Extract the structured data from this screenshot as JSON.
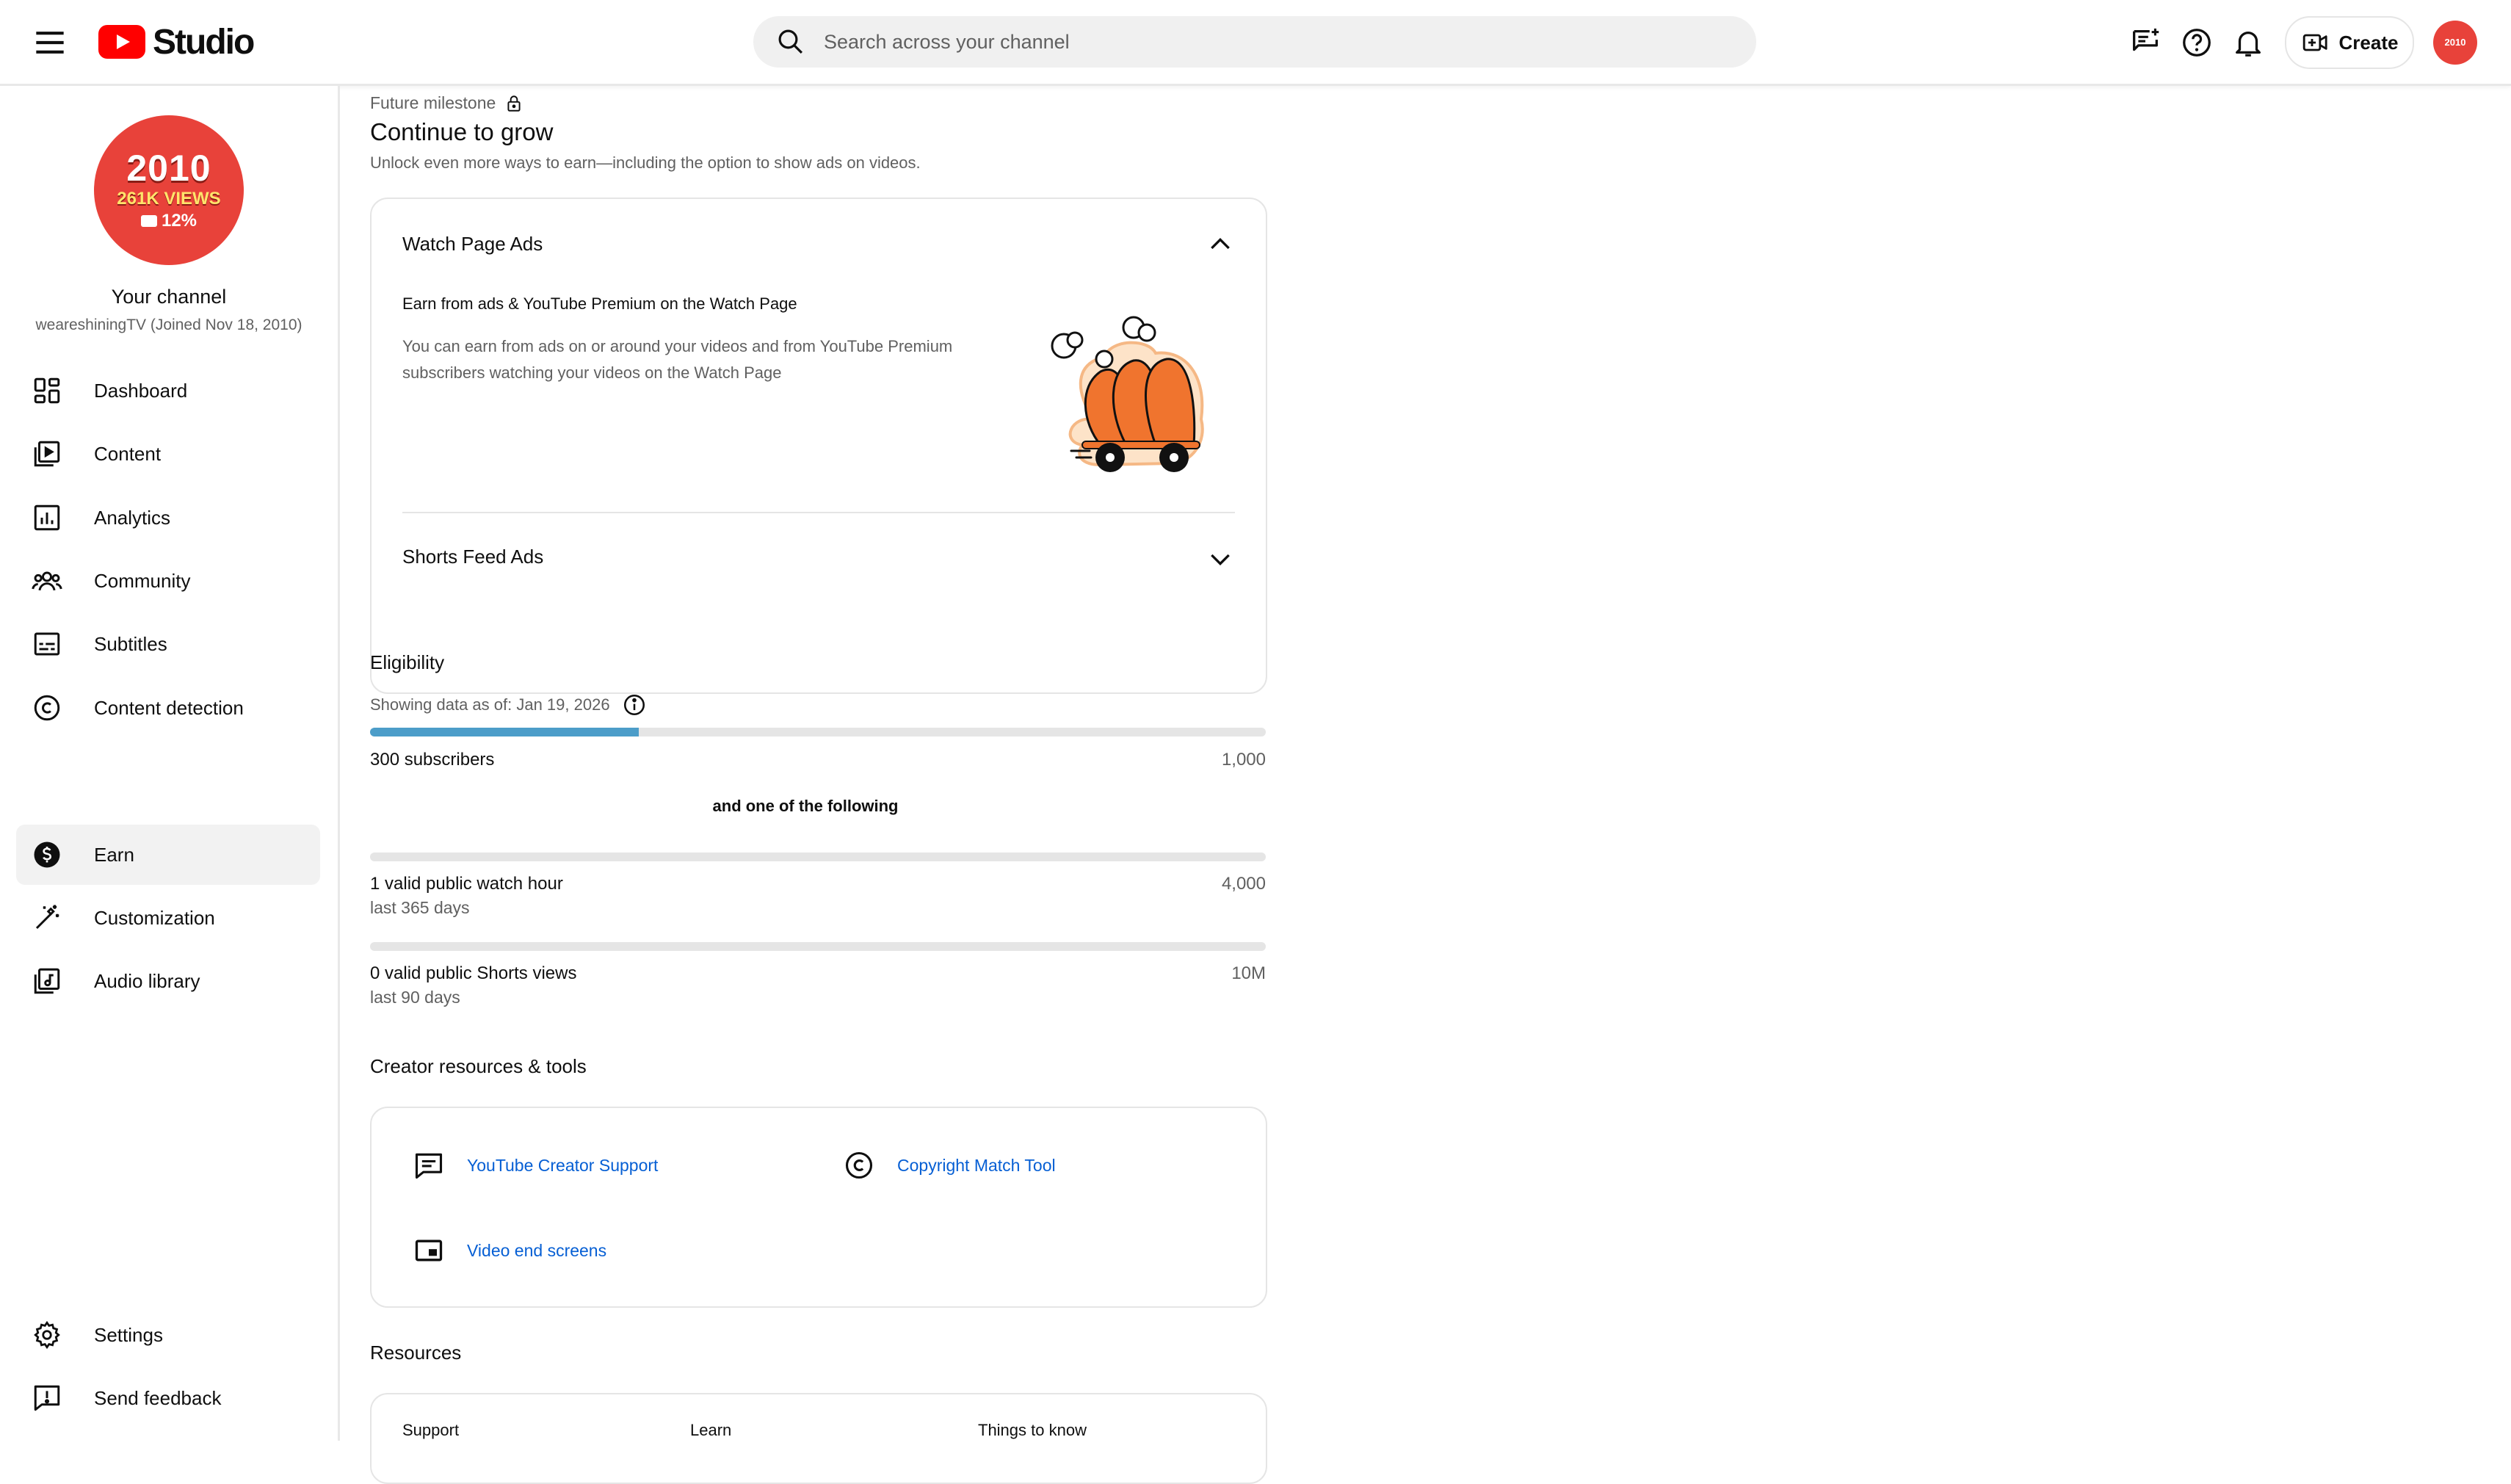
{
  "header": {
    "logo_text": "Studio",
    "search_placeholder": "Search across your channel",
    "create_label": "Create",
    "avatar_text": "2010"
  },
  "sidebar": {
    "avatar": {
      "year": "2010",
      "views": "261K VIEWS",
      "percent": "12%"
    },
    "channel_title": "Your channel",
    "channel_sub": "weareshiningTV (Joined Nov 18, 2010)",
    "items": [
      {
        "label": "Dashboard",
        "icon": "dashboard-icon"
      },
      {
        "label": "Content",
        "icon": "content-icon"
      },
      {
        "label": "Analytics",
        "icon": "analytics-icon"
      },
      {
        "label": "Community",
        "icon": "community-icon"
      },
      {
        "label": "Subtitles",
        "icon": "subtitles-icon"
      },
      {
        "label": "Content detection",
        "icon": "copyright-icon"
      },
      {
        "label": "Earn",
        "icon": "dollar-icon",
        "active": true
      },
      {
        "label": "Customization",
        "icon": "magic-wand-icon"
      },
      {
        "label": "Audio library",
        "icon": "audio-library-icon"
      }
    ],
    "bottom_items": [
      {
        "label": "Settings",
        "icon": "gear-icon"
      },
      {
        "label": "Send feedback",
        "icon": "feedback-icon"
      }
    ]
  },
  "main": {
    "milestone_label": "Future milestone",
    "milestone_title": "Continue to grow",
    "milestone_desc": "Unlock even more ways to earn—including the option to show ads on videos.",
    "accordion": {
      "watch_page": {
        "title": "Watch Page Ads",
        "subtitle": "Earn from ads & YouTube Premium on the Watch Page",
        "body_line1": "You can earn from ads on or around your videos and from YouTube Premium",
        "body_line2": "subscribers watching your videos on the Watch Page"
      },
      "shorts": {
        "title": "Shorts Feed Ads"
      }
    },
    "eligibility": {
      "title": "Eligibility",
      "as_of": "Showing data as of: Jan 19, 2026",
      "subscribers": {
        "label": "300 subscribers",
        "target": "1,000",
        "progress": 0.3
      },
      "or_text": "and one of the following",
      "watch_hours": {
        "label": "1 valid public watch hour",
        "sub": "last 365 days",
        "target": "4,000",
        "progress": 0.0
      },
      "shorts_views": {
        "label": "0 valid public Shorts views",
        "sub": "last 90 days",
        "target": "10M",
        "progress": 0.0
      }
    },
    "tools": {
      "title": "Creator resources & tools",
      "support": "YouTube Creator Support",
      "copyright": "Copyright Match Tool",
      "endscreens": "Video end screens"
    },
    "resources": {
      "title": "Resources",
      "columns": [
        "Support",
        "Learn",
        "Things to know"
      ]
    }
  },
  "colors": {
    "accent_blue": "#065fd4",
    "progress_fill": "#4c9dc9",
    "youtube_red": "#ff0000"
  }
}
